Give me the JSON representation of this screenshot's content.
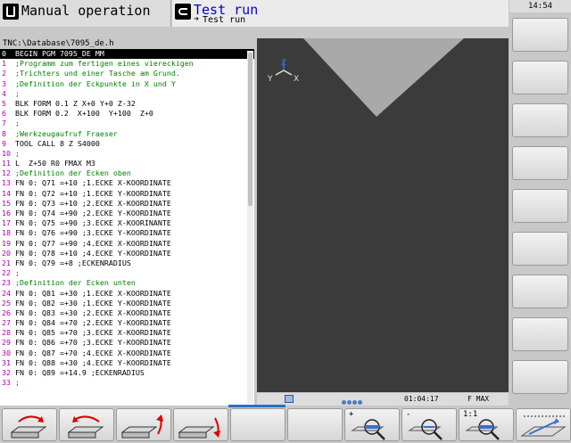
{
  "header": {
    "mode_left": "Manual operation",
    "mode_right": "Test run",
    "submode": "Test run",
    "clock": "14:54"
  },
  "path": "TNC:\\Database\\7095_de.h",
  "program": [
    {
      "num": "0",
      "text": "  BEGIN PGM 7095_DE MM",
      "kind": "bk",
      "selected": true
    },
    {
      "num": "1",
      "text": "  ;Programm zum fertigen eines viereckigen",
      "kind": "cm"
    },
    {
      "num": "2",
      "text": "  ;Trichters und einer Tasche am Grund.",
      "kind": "cm"
    },
    {
      "num": "3",
      "text": "  ;Definition der Eckpunkte in X und Y",
      "kind": "cm"
    },
    {
      "num": "4",
      "text": "  ;",
      "kind": "cm"
    },
    {
      "num": "5",
      "text": "  BLK FORM 0.1 Z X+0 Y+0 Z-32",
      "kind": "blk"
    },
    {
      "num": "6",
      "text": "  BLK FORM 0.2  X+100  Y+100  Z+0",
      "kind": "blk"
    },
    {
      "num": "7",
      "text": "  ;",
      "kind": "cm"
    },
    {
      "num": "8",
      "text": "  ;Werkzeugaufruf Fraeser",
      "kind": "cm"
    },
    {
      "num": "9",
      "text": "  TOOL CALL 8 Z S4000",
      "kind": "tool"
    },
    {
      "num": "10",
      "text": " ;",
      "kind": "cm"
    },
    {
      "num": "11",
      "text": " L  Z+50 R0 FMAX M3",
      "kind": "lin"
    },
    {
      "num": "12",
      "text": " ;Definition der Ecken oben",
      "kind": "cm"
    },
    {
      "num": "13",
      "text": " FN 0: Q71 =+10 ;1.ECKE X-KOORDINATE",
      "kind": "fn"
    },
    {
      "num": "14",
      "text": " FN 0: Q72 =+10 ;1.ECKE Y-KOORDINATE",
      "kind": "fn"
    },
    {
      "num": "15",
      "text": " FN 0: Q73 =+10 ;2.ECKE X-KOORDINATE",
      "kind": "fn"
    },
    {
      "num": "16",
      "text": " FN 0: Q74 =+90 ;2.ECKE Y-KOORDINATE",
      "kind": "fn"
    },
    {
      "num": "17",
      "text": " FN 0: Q75 =+90 ;3.ECKE X-KOORINANTE",
      "kind": "fn"
    },
    {
      "num": "18",
      "text": " FN 0: Q76 =+90 ;3.ECKE Y-KOORDINATE",
      "kind": "fn"
    },
    {
      "num": "19",
      "text": " FN 0: Q77 =+90 ;4.ECKE X-KOORDINATE",
      "kind": "fn"
    },
    {
      "num": "20",
      "text": " FN 0: Q78 =+10 ;4.ECKE Y-KOORDINATE",
      "kind": "fn"
    },
    {
      "num": "21",
      "text": " FN 0: Q79 =+8 ;ECKENRADIUS",
      "kind": "fn"
    },
    {
      "num": "22",
      "text": " ;",
      "kind": "cm"
    },
    {
      "num": "23",
      "text": " ;Definition der Ecken unten",
      "kind": "cm"
    },
    {
      "num": "24",
      "text": " FN 0: Q81 =+30 ;1.ECKE X-KOORDINATE",
      "kind": "fn"
    },
    {
      "num": "25",
      "text": " FN 0: Q82 =+30 ;1.ECKE Y-KOORDINATE",
      "kind": "fn"
    },
    {
      "num": "26",
      "text": " FN 0: Q83 =+30 ;2.ECKE X-KOORDINATE",
      "kind": "fn"
    },
    {
      "num": "27",
      "text": " FN 0: Q84 =+70 ;2.ECKE Y-KOORDINATE",
      "kind": "fn"
    },
    {
      "num": "28",
      "text": " FN 0: Q85 =+70 ;3.ECKE X-KOORDINATE",
      "kind": "fn"
    },
    {
      "num": "29",
      "text": " FN 0: Q86 =+70 ;3.ECKE Y-KOORDINATE",
      "kind": "fn"
    },
    {
      "num": "30",
      "text": " FN 0: Q87 =+70 ;4.ECKE X-KOORDINATE",
      "kind": "fn"
    },
    {
      "num": "31",
      "text": " FN 0: Q88 =+30 ;4.ECKE Y-KOORDINATE",
      "kind": "fn"
    },
    {
      "num": "32",
      "text": " FN 0: Q89 =+14.9 ;ECKENRADIUS",
      "kind": "fn"
    },
    {
      "num": "33",
      "text": " ;",
      "kind": "cm"
    }
  ],
  "graphics": {
    "axis_z": "Z",
    "axis_y": "Y",
    "axis_x": "X",
    "background": "#3b3b3b",
    "workpiece": "#a9a9a9"
  },
  "status": {
    "time": "01:04:17",
    "feed": "F MAX"
  },
  "softkeys": {
    "zoom_in": "+",
    "zoom_out": "-",
    "scale": "1:1"
  }
}
